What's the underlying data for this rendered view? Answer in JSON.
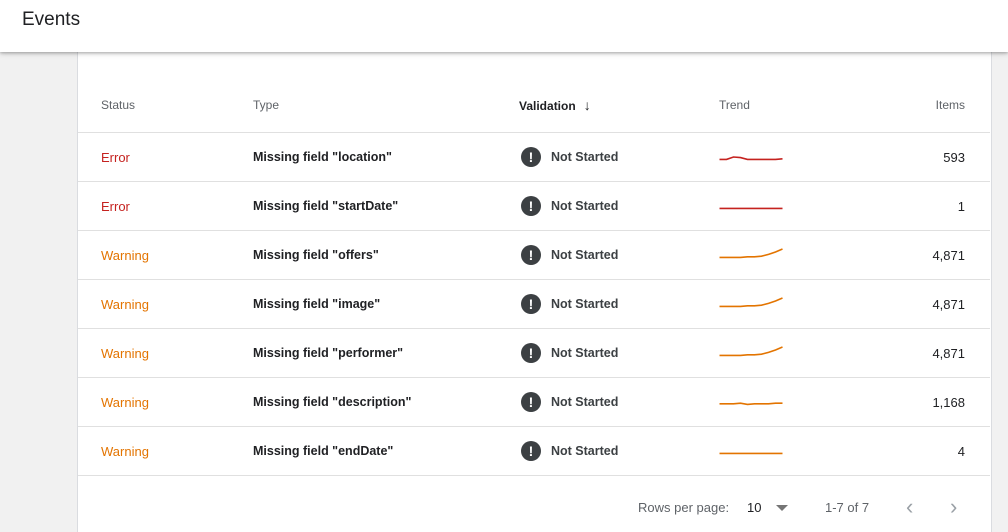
{
  "header": {
    "title": "Events"
  },
  "table": {
    "columns": {
      "status": "Status",
      "type": "Type",
      "validation": "Validation",
      "trend": "Trend",
      "items": "Items"
    },
    "rows": [
      {
        "status": "Error",
        "type": "Missing field \"location\"",
        "validation": "Not Started",
        "items": "593",
        "trend": [
          0.3,
          0.3,
          0.5,
          0.45,
          0.3,
          0.3,
          0.3,
          0.3,
          0.3,
          0.35
        ]
      },
      {
        "status": "Error",
        "type": "Missing field \"startDate\"",
        "validation": "Not Started",
        "items": "1",
        "trend": [
          0.3,
          0.3,
          0.3,
          0.3,
          0.3,
          0.3,
          0.3,
          0.3,
          0.3,
          0.3
        ]
      },
      {
        "status": "Warning",
        "type": "Missing field \"offers\"",
        "validation": "Not Started",
        "items": "4,871",
        "trend": [
          0.3,
          0.3,
          0.3,
          0.3,
          0.35,
          0.35,
          0.4,
          0.55,
          0.75,
          1.0
        ]
      },
      {
        "status": "Warning",
        "type": "Missing field \"image\"",
        "validation": "Not Started",
        "items": "4,871",
        "trend": [
          0.3,
          0.3,
          0.3,
          0.3,
          0.35,
          0.35,
          0.4,
          0.55,
          0.75,
          1.0
        ]
      },
      {
        "status": "Warning",
        "type": "Missing field \"performer\"",
        "validation": "Not Started",
        "items": "4,871",
        "trend": [
          0.3,
          0.3,
          0.3,
          0.3,
          0.35,
          0.35,
          0.4,
          0.55,
          0.75,
          1.0
        ]
      },
      {
        "status": "Warning",
        "type": "Missing field \"description\"",
        "validation": "Not Started",
        "items": "1,168",
        "trend": [
          0.35,
          0.35,
          0.35,
          0.4,
          0.3,
          0.35,
          0.35,
          0.35,
          0.4,
          0.4
        ]
      },
      {
        "status": "Warning",
        "type": "Missing field \"endDate\"",
        "validation": "Not Started",
        "items": "4",
        "trend": [
          0.3,
          0.3,
          0.3,
          0.3,
          0.3,
          0.3,
          0.3,
          0.3,
          0.3,
          0.3
        ]
      }
    ]
  },
  "pagination": {
    "rows_per_page_label": "Rows per page:",
    "rows_per_page_value": "10",
    "range": "1-7 of 7"
  },
  "colors": {
    "error": "#c5221f",
    "warning": "#e37400",
    "validation_icon": "#3c4043"
  },
  "icons": {
    "sort": "arrow-down-icon",
    "validation": "exclamation-circle-icon",
    "prev": "chevron-left-icon",
    "next": "chevron-right-icon",
    "dropdown": "caret-down-icon"
  }
}
